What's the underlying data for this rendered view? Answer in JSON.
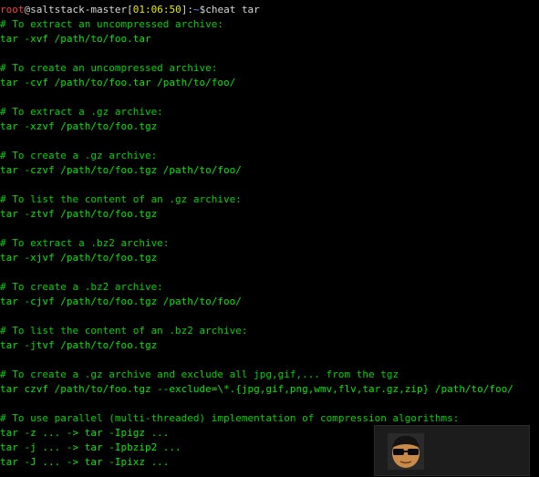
{
  "prompt": {
    "user": "root",
    "at": "@",
    "host": "saltstack-master",
    "time": "01:06:50",
    "path": "~",
    "symbol": "$",
    "command": "cheat tar"
  },
  "output": [
    {
      "kind": "comment",
      "text": "# To extract an uncompressed archive:"
    },
    {
      "kind": "cmd",
      "text": "tar -xvf /path/to/foo.tar"
    },
    {
      "kind": "blank",
      "text": ""
    },
    {
      "kind": "comment",
      "text": "# To create an uncompressed archive:"
    },
    {
      "kind": "cmd",
      "text": "tar -cvf /path/to/foo.tar /path/to/foo/"
    },
    {
      "kind": "blank",
      "text": ""
    },
    {
      "kind": "comment",
      "text": "# To extract a .gz archive:"
    },
    {
      "kind": "cmd",
      "text": "tar -xzvf /path/to/foo.tgz"
    },
    {
      "kind": "blank",
      "text": ""
    },
    {
      "kind": "comment",
      "text": "# To create a .gz archive:"
    },
    {
      "kind": "cmd",
      "text": "tar -czvf /path/to/foo.tgz /path/to/foo/"
    },
    {
      "kind": "blank",
      "text": ""
    },
    {
      "kind": "comment",
      "text": "# To list the content of an .gz archive:"
    },
    {
      "kind": "cmd",
      "text": "tar -ztvf /path/to/foo.tgz"
    },
    {
      "kind": "blank",
      "text": ""
    },
    {
      "kind": "comment",
      "text": "# To extract a .bz2 archive:"
    },
    {
      "kind": "cmd",
      "text": "tar -xjvf /path/to/foo.tgz"
    },
    {
      "kind": "blank",
      "text": ""
    },
    {
      "kind": "comment",
      "text": "# To create a .bz2 archive:"
    },
    {
      "kind": "cmd",
      "text": "tar -cjvf /path/to/foo.tgz /path/to/foo/"
    },
    {
      "kind": "blank",
      "text": ""
    },
    {
      "kind": "comment",
      "text": "# To list the content of an .bz2 archive:"
    },
    {
      "kind": "cmd",
      "text": "tar -jtvf /path/to/foo.tgz"
    },
    {
      "kind": "blank",
      "text": ""
    },
    {
      "kind": "comment",
      "text": "# To create a .gz archive and exclude all jpg,gif,... from the tgz"
    },
    {
      "kind": "cmd",
      "text": "tar czvf /path/to/foo.tgz --exclude=\\*.{jpg,gif,png,wmv,flv,tar.gz,zip} /path/to/foo/"
    },
    {
      "kind": "blank",
      "text": ""
    },
    {
      "kind": "comment",
      "text": "# To use parallel (multi-threaded) implementation of compression algorithms:"
    },
    {
      "kind": "cmd",
      "text": "tar -z ... -> tar -Ipigz ..."
    },
    {
      "kind": "cmd",
      "text": "tar -j ... -> tar -Ipbzip2 ..."
    },
    {
      "kind": "cmd",
      "text": "tar -J ... -> tar -Ipixz ..."
    }
  ],
  "colors": {
    "background": "#000000",
    "output_green": "#00e600",
    "user_red": "#ff3b3b",
    "time_yellow": "#e8e800",
    "path_blue": "#6e8cff"
  },
  "icons": {
    "watermark": "sunglasses-avatar-icon"
  }
}
